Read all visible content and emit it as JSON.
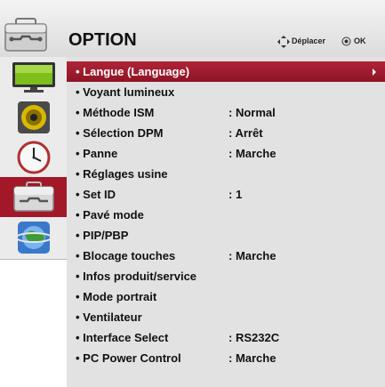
{
  "header": {
    "title": "OPTION",
    "move_hint": "Déplacer",
    "ok_hint": "OK",
    "icon": "toolbox-icon"
  },
  "sidebar": {
    "tabs": [
      {
        "name": "picture-tab",
        "icon": "monitor-icon",
        "selected": false
      },
      {
        "name": "audio-tab",
        "icon": "speaker-icon",
        "selected": false
      },
      {
        "name": "time-tab",
        "icon": "clock-icon",
        "selected": false
      },
      {
        "name": "option-tab",
        "icon": "toolbox-icon",
        "selected": true
      },
      {
        "name": "network-tab",
        "icon": "globe-icon",
        "selected": false
      }
    ]
  },
  "menu": {
    "items": [
      {
        "label": "• Langue (Language)",
        "value": "",
        "selected": true
      },
      {
        "label": "• Voyant lumineux",
        "value": ""
      },
      {
        "label": "• Méthode ISM",
        "value": ": Normal"
      },
      {
        "label": "• Sélection DPM",
        "value": ": Arrêt"
      },
      {
        "label": "• Panne",
        "value": ": Marche"
      },
      {
        "label": "• Réglages usine",
        "value": ""
      },
      {
        "label": "• Set ID",
        "value": ": 1"
      },
      {
        "label": "• Pavé mode",
        "value": ""
      },
      {
        "label": "• PIP/PBP",
        "value": ""
      },
      {
        "label": "• Blocage touches",
        "value": ": Marche"
      },
      {
        "label": "• Infos produit/service",
        "value": ""
      },
      {
        "label": "• Mode portrait",
        "value": ""
      },
      {
        "label": "• Ventilateur",
        "value": ""
      },
      {
        "label": "• Interface Select",
        "value": ": RS232C"
      },
      {
        "label": "• PC Power Control",
        "value": ": Marche"
      }
    ]
  },
  "colors": {
    "accent": "#a21829",
    "panel": "#e2e2e2",
    "header": "#dcdcdc"
  }
}
